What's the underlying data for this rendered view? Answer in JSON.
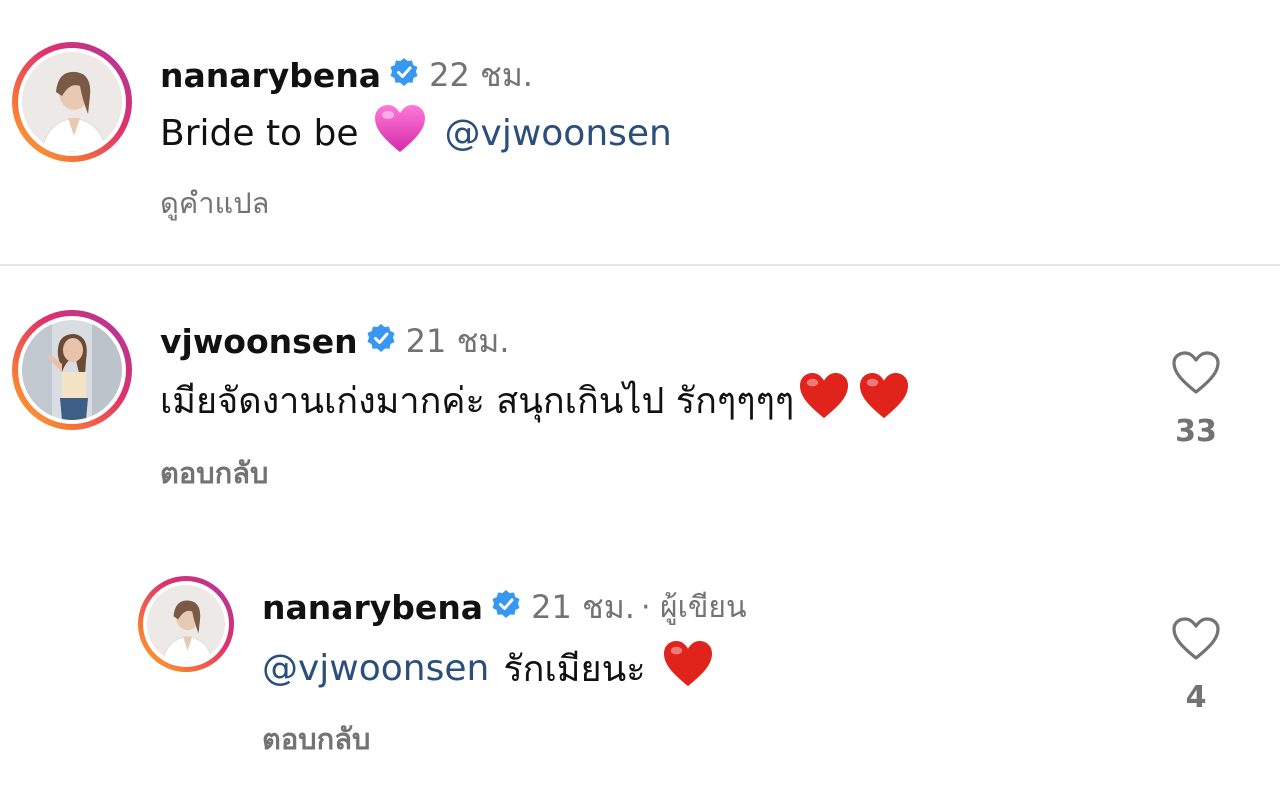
{
  "post": {
    "username": "nanarybena",
    "time": "22 ชม.",
    "caption_text": "Bride to be",
    "caption_mention": "@vjwoonsen",
    "translate_label": "ดูคำแปล"
  },
  "comments": [
    {
      "username": "vjwoonsen",
      "time": "21 ชม.",
      "text": "เมียจัดงานเก่งมากค่ะ สนุกเกินไป รักๆๆๆๆ",
      "reply_label": "ตอบกลับ",
      "likes": "33"
    },
    {
      "username": "nanarybena",
      "time": "21 ชม.",
      "author_tag": "· ผู้เขียน",
      "mention": "@vjwoonsen",
      "text": "รักเมียนะ",
      "reply_label": "ตอบกลับ",
      "likes": "4"
    }
  ],
  "colors": {
    "verified": "#3897f0",
    "heart_red": "#e0241b",
    "heart_pink": "#f04ac0",
    "mention": "#2b4f7a",
    "muted": "#737373"
  },
  "icons": [
    "verified-badge-icon",
    "heart-outline-icon",
    "red-heart-emoji-icon",
    "pink-heart-emoji-icon"
  ]
}
